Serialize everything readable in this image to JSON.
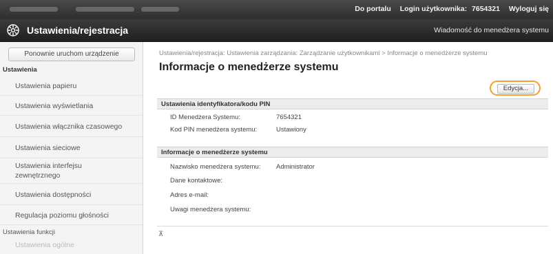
{
  "topbar": {
    "to_portal": "Do portalu",
    "login_label": "Login użytkownika:",
    "user_id": "7654321",
    "logout": "Wyloguj się"
  },
  "header": {
    "title": "Ustawienia/rejestracja",
    "message": "Wiadomość do menedżera systemu"
  },
  "sidebar": {
    "restart_button": "Ponownie uruchom urządzenie",
    "group_settings": "Ustawienia",
    "items": [
      {
        "label": "Ustawienia papieru"
      },
      {
        "label": "Ustawienia wyświetlania"
      },
      {
        "label": "Ustawienia włącznika czasowego"
      },
      {
        "label": "Ustawienia sieciowe"
      },
      {
        "line1": "Ustawienia interfejsu",
        "line2": "zewnętrznego"
      },
      {
        "label": "Ustawienia dostępności"
      },
      {
        "label": "Regulacja poziomu głośności"
      }
    ],
    "group_functions": "Ustawienia funkcji",
    "general": "Ustawienia ogólne"
  },
  "main": {
    "breadcrumb": "Ustawienia/rejestracja: Ustawienia zarządzania: Zarządzanie użytkownikami > Informacje o menedżerze systemu",
    "title": "Informacje o menedżerze systemu",
    "edit_button": "Edycja...",
    "section1": {
      "heading": "Ustawienia identyfikatora/kodu PIN",
      "rows": [
        {
          "label": "ID Menedżera Systemu:",
          "value": "7654321"
        },
        {
          "label": "Kod PIN menedżera systemu:",
          "value": "Ustawiony"
        }
      ]
    },
    "section2": {
      "heading": "Informacje o menedżerze systemu",
      "rows": [
        {
          "label": "Nazwisko menedżera systemu:",
          "value": "Administrator"
        },
        {
          "label": "Dane kontaktowe:",
          "value": ""
        },
        {
          "label": "Adres e-mail:",
          "value": ""
        },
        {
          "label": "Uwagi menedżera systemu:",
          "value": ""
        }
      ]
    },
    "top_icon": "⊼"
  }
}
